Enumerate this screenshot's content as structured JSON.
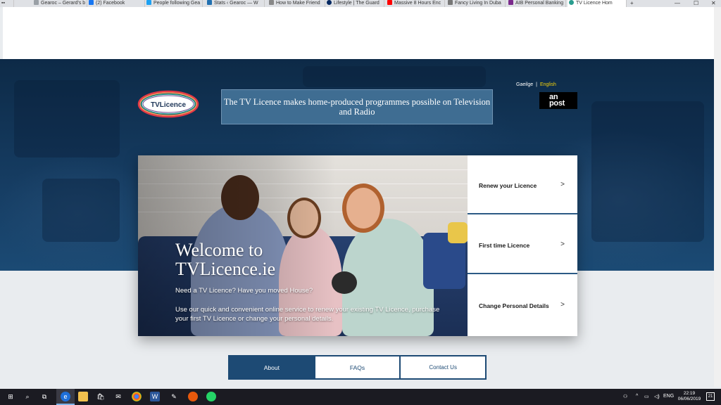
{
  "browser": {
    "tabs": [
      {
        "label": "Gearoc – Gerard's b",
        "icon_color": "#9aa0a6"
      },
      {
        "label": "(2) Facebook",
        "icon_color": "#1877f2"
      },
      {
        "label": "People following Gea",
        "icon_color": "#1da1f2"
      },
      {
        "label": "Stats ‹ Gearoc — W",
        "icon_color": "#2271b1"
      },
      {
        "label": "How to Make Friend",
        "icon_color": "#888888"
      },
      {
        "label": "Lifestyle | The Guard",
        "icon_color": "#052962"
      },
      {
        "label": "Massive 8 Hours Enc",
        "icon_color": "#ff0000"
      },
      {
        "label": "Fancy Living In Duba",
        "icon_color": "#777777"
      },
      {
        "label": "AIB Personal Banking",
        "icon_color": "#7b2a8c"
      },
      {
        "label": "TV Licence Hom",
        "icon_color": "#2a9d8f"
      }
    ],
    "new_tab": "+",
    "controls": {
      "minimize": "—",
      "maximize": "☐",
      "close": "✕"
    }
  },
  "header": {
    "logo_text": "TVLicence",
    "banner": "The TV Licence makes home-produced programmes possible on Television and Radio",
    "lang": {
      "irish": "Gaeilge",
      "separator": "|",
      "english": "English"
    },
    "anpost_line1": "an",
    "anpost_line2": "post"
  },
  "hero": {
    "title": "Welcome to TVLicence.ie",
    "lead": "Need a TV Licence? Have you moved House?",
    "description": "Use our quick and convenient online service to renew your existing TV Licence, purchase your first TV Licence or change your personal details."
  },
  "actions": [
    {
      "label": "Renew your Licence"
    },
    {
      "label": "First time Licence"
    },
    {
      "label": "Change Personal Details"
    }
  ],
  "nav": {
    "about": "About",
    "faqs": "FAQs",
    "contact": "Contact Us"
  },
  "taskbar": {
    "tray": {
      "lang": "ENG"
    },
    "time": "22:19",
    "date": "06/06/2019",
    "notifications": "21"
  },
  "colors": {
    "hero_dark": "#0d2a47",
    "banner_bg": "#3f6d92",
    "nav_blue": "#1d4a74",
    "lang_selected": "#f5d20a"
  }
}
